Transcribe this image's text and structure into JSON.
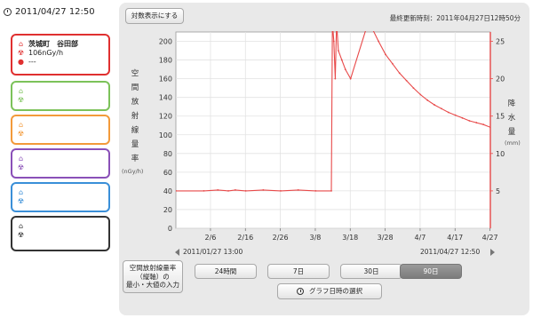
{
  "sidebar": {
    "datetime": "2011/04/27 12:50",
    "stations": [
      {
        "color": "#e03030",
        "name": "茨城町　谷田部",
        "dose": "106nGy/h",
        "rain": "---",
        "has_text": true
      },
      {
        "color": "#7cc25a",
        "has_text": false
      },
      {
        "color": "#f39a3a",
        "has_text": false
      },
      {
        "color": "#8a50b8",
        "has_text": false
      },
      {
        "color": "#3a8fd8",
        "has_text": false
      },
      {
        "color": "#333333",
        "has_text": false
      }
    ]
  },
  "toolbar": {
    "log_button": "対数表示にする",
    "last_updated": "最終更新時刻：2011年04月27日12時50分"
  },
  "axes": {
    "left_label_chars": [
      "空",
      "間",
      "放",
      "射",
      "線",
      "量",
      "率"
    ],
    "left_unit": "(nGy/h)",
    "right_label_chars": [
      "降",
      "水",
      "量"
    ],
    "right_unit": "(mm)"
  },
  "range": {
    "start": "2011/01/27 13:00",
    "end": "2011/04/27 12:50"
  },
  "controls": {
    "minmax_button": "空間放射線量率\n（縦軸）の\n最小・大値の入力",
    "period_buttons": [
      "24時間",
      "7日",
      "30日",
      "90日"
    ],
    "active_period": "90日",
    "graph_date_select": "グラフ日時の選択"
  },
  "chart_data": {
    "type": "line",
    "title": "",
    "xlabel": "",
    "ylabel": "空間放射線量率 (nGy/h)",
    "y2label": "降水量 (mm)",
    "x_ticks": [
      "2/6",
      "2/16",
      "2/26",
      "3/8",
      "3/18",
      "3/28",
      "4/7",
      "4/17",
      "4/27"
    ],
    "x_range_days": [
      0,
      90
    ],
    "ylim": [
      0,
      210
    ],
    "y_ticks": [
      0,
      20,
      40,
      60,
      80,
      100,
      120,
      140,
      160,
      180,
      200
    ],
    "y2lim": [
      0,
      26.25
    ],
    "y2_ticks": [
      5,
      10,
      15,
      20,
      25
    ],
    "grid": true,
    "series": [
      {
        "name": "空間放射線量率",
        "color": "#e84a4a",
        "x": [
          0,
          8,
          12,
          15,
          17,
          20,
          25,
          30,
          35,
          40,
          44.5,
          44.8,
          45.2,
          45.6,
          46.0,
          46.5,
          47.5,
          48.5,
          50,
          55,
          56,
          58,
          60,
          62,
          64,
          66,
          68,
          70,
          72,
          74,
          76,
          78,
          80,
          82,
          84,
          86,
          88,
          90
        ],
        "y": [
          40,
          40,
          41,
          40,
          41,
          40,
          41,
          40,
          41,
          40,
          40,
          220,
          200,
          160,
          220,
          190,
          180,
          170,
          160,
          220,
          215,
          200,
          186,
          176,
          166,
          158,
          150,
          143,
          137,
          132,
          128,
          124,
          121,
          118,
          115,
          113,
          111,
          108
        ]
      }
    ]
  }
}
